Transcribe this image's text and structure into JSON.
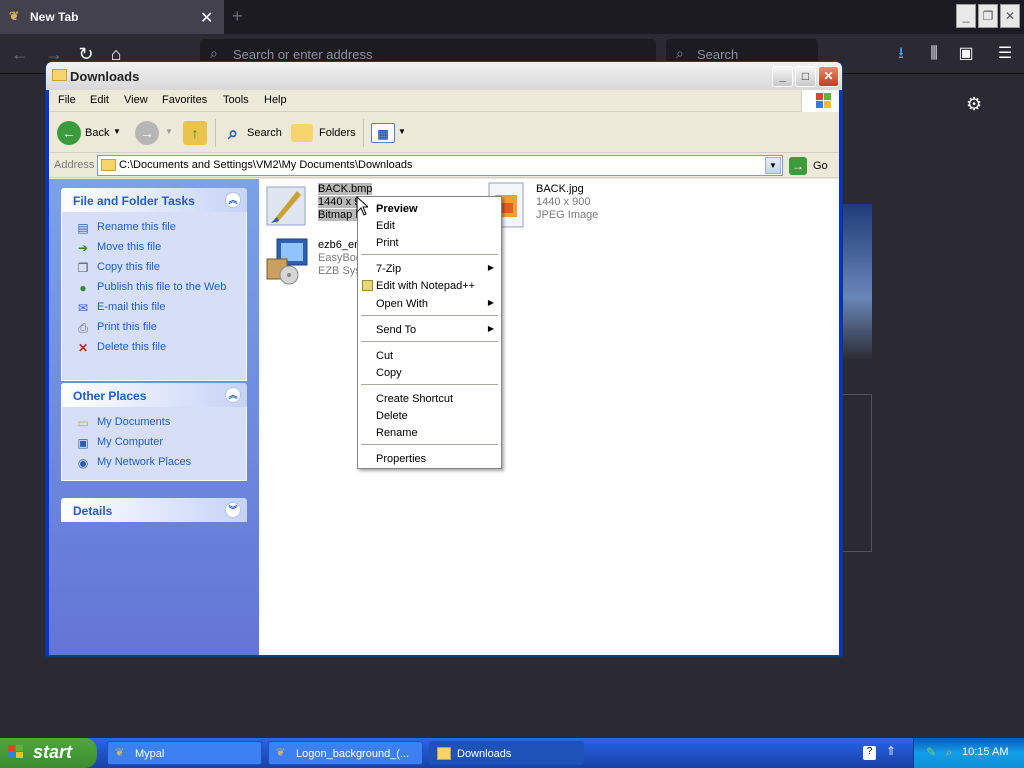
{
  "firefox": {
    "tab_title": "New Tab",
    "tab_close": "✕",
    "new_tab": "+",
    "url_placeholder": "Search or enter address",
    "search_placeholder": "Search"
  },
  "window": {
    "title": "Downloads",
    "min": "_",
    "max": "□",
    "close": "✕"
  },
  "menubar": [
    "File",
    "Edit",
    "View",
    "Favorites",
    "Tools",
    "Help"
  ],
  "toolbar": {
    "back": "Back",
    "search": "Search",
    "folders": "Folders"
  },
  "address": {
    "label": "Address",
    "value": "C:\\Documents and Settings\\VM2\\My Documents\\Downloads",
    "go": "Go"
  },
  "tasks": {
    "title": "File and Folder Tasks",
    "items": [
      {
        "label": "Rename this file",
        "icon": "rename-icon"
      },
      {
        "label": "Move this file",
        "icon": "move-icon"
      },
      {
        "label": "Copy this file",
        "icon": "copy-icon"
      },
      {
        "label": "Publish this file to the Web",
        "icon": "globe-icon"
      },
      {
        "label": "E-mail this file",
        "icon": "email-icon"
      },
      {
        "label": "Print this file",
        "icon": "printer-icon"
      },
      {
        "label": "Delete this file",
        "icon": "delete-icon"
      }
    ]
  },
  "other_places": {
    "title": "Other Places",
    "items": [
      {
        "label": "My Documents",
        "icon": "my-documents-icon"
      },
      {
        "label": "My Computer",
        "icon": "my-computer-icon"
      },
      {
        "label": "My Network Places",
        "icon": "network-places-icon"
      }
    ]
  },
  "details": {
    "title": "Details"
  },
  "files": [
    {
      "name": "BACK.bmp",
      "line1": "1440 x 9",
      "line2": "Bitmap Ir",
      "selected": true
    },
    {
      "name": "BACK.jpg",
      "line1": "1440 x 900",
      "line2": "JPEG Image",
      "selected": false
    },
    {
      "name": "ezb6_en",
      "line1": "EasyBoo",
      "line2": "EZB Syst",
      "selected": false
    }
  ],
  "context_menu": {
    "preview": "Preview",
    "edit": "Edit",
    "print": "Print",
    "zip": "7-Zip",
    "notepad": "Edit with Notepad++",
    "open_with": "Open With",
    "send_to": "Send To",
    "cut": "Cut",
    "copy": "Copy",
    "create_shortcut": "Create Shortcut",
    "delete": "Delete",
    "rename": "Rename",
    "properties": "Properties"
  },
  "taskbar": {
    "start": "start",
    "items": [
      "Mypal",
      "Logon_background_(...",
      "Downloads"
    ],
    "time": "10:15 AM"
  }
}
